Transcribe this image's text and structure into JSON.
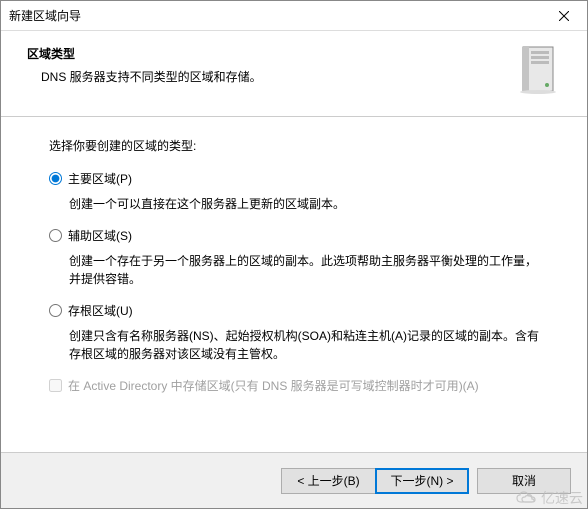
{
  "window": {
    "title": "新建区域向导"
  },
  "header": {
    "title": "区域类型",
    "subtitle": "DNS 服务器支持不同类型的区域和存储。"
  },
  "body": {
    "prompt": "选择你要创建的区域的类型:",
    "options": [
      {
        "label": "主要区域(P)",
        "description": "创建一个可以直接在这个服务器上更新的区域副本。",
        "selected": true
      },
      {
        "label": "辅助区域(S)",
        "description": "创建一个存在于另一个服务器上的区域的副本。此选项帮助主服务器平衡处理的工作量，并提供容错。",
        "selected": false
      },
      {
        "label": "存根区域(U)",
        "description": "创建只含有名称服务器(NS)、起始授权机构(SOA)和粘连主机(A)记录的区域的副本。含有存根区域的服务器对该区域没有主管权。",
        "selected": false
      }
    ],
    "ad_checkbox": {
      "label": "在 Active Directory 中存储区域(只有 DNS 服务器是可写域控制器时才可用)(A)",
      "enabled": false,
      "checked": false
    }
  },
  "footer": {
    "back": "< 上一步(B)",
    "next": "下一步(N) >",
    "cancel": "取消"
  },
  "watermark": "亿速云"
}
